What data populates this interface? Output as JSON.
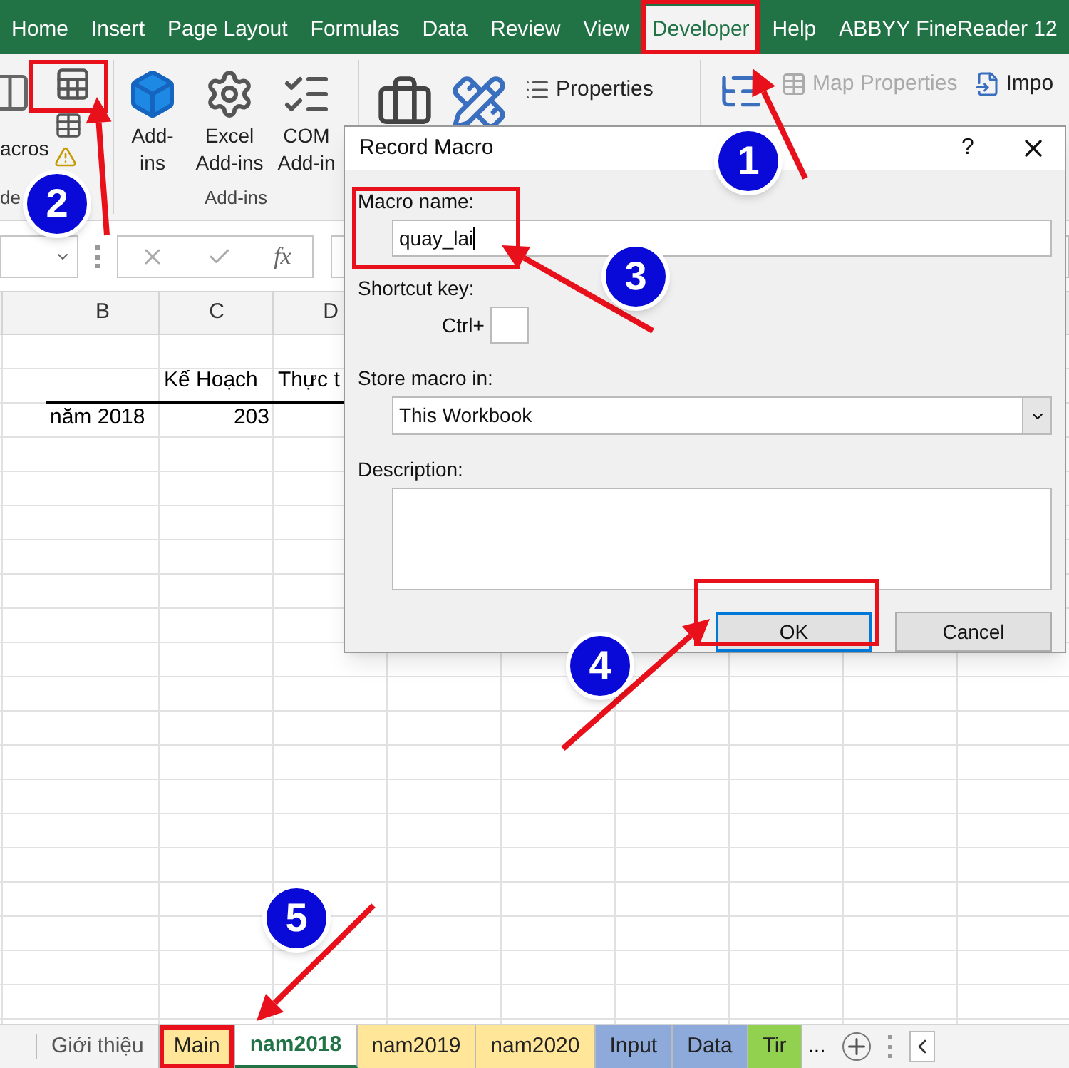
{
  "ribbon_tabs": [
    {
      "label": "Home",
      "selected": false
    },
    {
      "label": "Insert",
      "selected": false
    },
    {
      "label": "Page Layout",
      "selected": false
    },
    {
      "label": "Formulas",
      "selected": false
    },
    {
      "label": "Data",
      "selected": false
    },
    {
      "label": "Review",
      "selected": false
    },
    {
      "label": "View",
      "selected": false
    },
    {
      "label": "Developer",
      "selected": true
    },
    {
      "label": "Help",
      "selected": false
    },
    {
      "label": "ABBYY FineReader 12",
      "selected": false
    }
  ],
  "ribbon": {
    "code_group": {
      "button_label": "acros",
      "group_label": "de"
    },
    "addins_group": {
      "group_label": "Add-ins",
      "buttons": [
        {
          "kind": "cube",
          "lines": [
            "Add-",
            "ins"
          ]
        },
        {
          "kind": "gears",
          "lines": [
            "Excel",
            "Add-ins"
          ]
        },
        {
          "kind": "checklist",
          "lines": [
            "COM",
            "Add-in"
          ]
        }
      ]
    },
    "controls_group": {
      "items": [
        {
          "label": "Properties",
          "disabled": false
        }
      ]
    },
    "xml_group": {
      "items": [
        {
          "label": "Map Properties",
          "disabled": true
        }
      ],
      "cut_label": "Impo"
    }
  },
  "formula_bar": {
    "function_label": "fx"
  },
  "sheet": {
    "column_headers": [
      "B",
      "C",
      "D"
    ],
    "rows": [
      {
        "cells": [
          {
            "text": "",
            "kind": "text"
          },
          {
            "text": "",
            "kind": "text"
          },
          {
            "text": "Kế Hoạch",
            "kind": "text"
          },
          {
            "text": "Thực t",
            "kind": "text"
          }
        ]
      },
      {
        "cells": [
          {
            "text": "",
            "kind": "text"
          },
          {
            "text": "năm 2018",
            "kind": "text"
          },
          {
            "text": "203",
            "kind": "number"
          }
        ]
      }
    ]
  },
  "dialog": {
    "title": "Record Macro",
    "help": "?",
    "macro_name": {
      "label": "Macro name:",
      "value": "quay_lai"
    },
    "shortcut": {
      "label": "Shortcut key:",
      "prefix": "Ctrl+"
    },
    "store_in": {
      "label": "Store macro in:",
      "value": "This Workbook"
    },
    "description": {
      "label": "Description:"
    },
    "buttons": [
      {
        "label": "OK",
        "default": true
      },
      {
        "label": "Cancel",
        "default": false
      }
    ]
  },
  "sheet_tabs": [
    {
      "label": "Giới thiệu",
      "selected": false
    },
    {
      "label": "Main",
      "selected": false,
      "color": "#ffe699"
    },
    {
      "label": "nam2018",
      "selected": true
    },
    {
      "label": "nam2019",
      "selected": false,
      "color": "#ffe699"
    },
    {
      "label": "nam2020",
      "selected": false,
      "color": "#ffe699"
    },
    {
      "label": "Input",
      "selected": false,
      "color": "#8eaadb"
    },
    {
      "label": "Data",
      "selected": false,
      "color": "#8eaadb"
    },
    {
      "label": "Tir",
      "selected": false,
      "color": "#92d050"
    }
  ],
  "sheet_tabs_more": "...",
  "steps": [
    "1",
    "2",
    "3",
    "4",
    "5"
  ]
}
